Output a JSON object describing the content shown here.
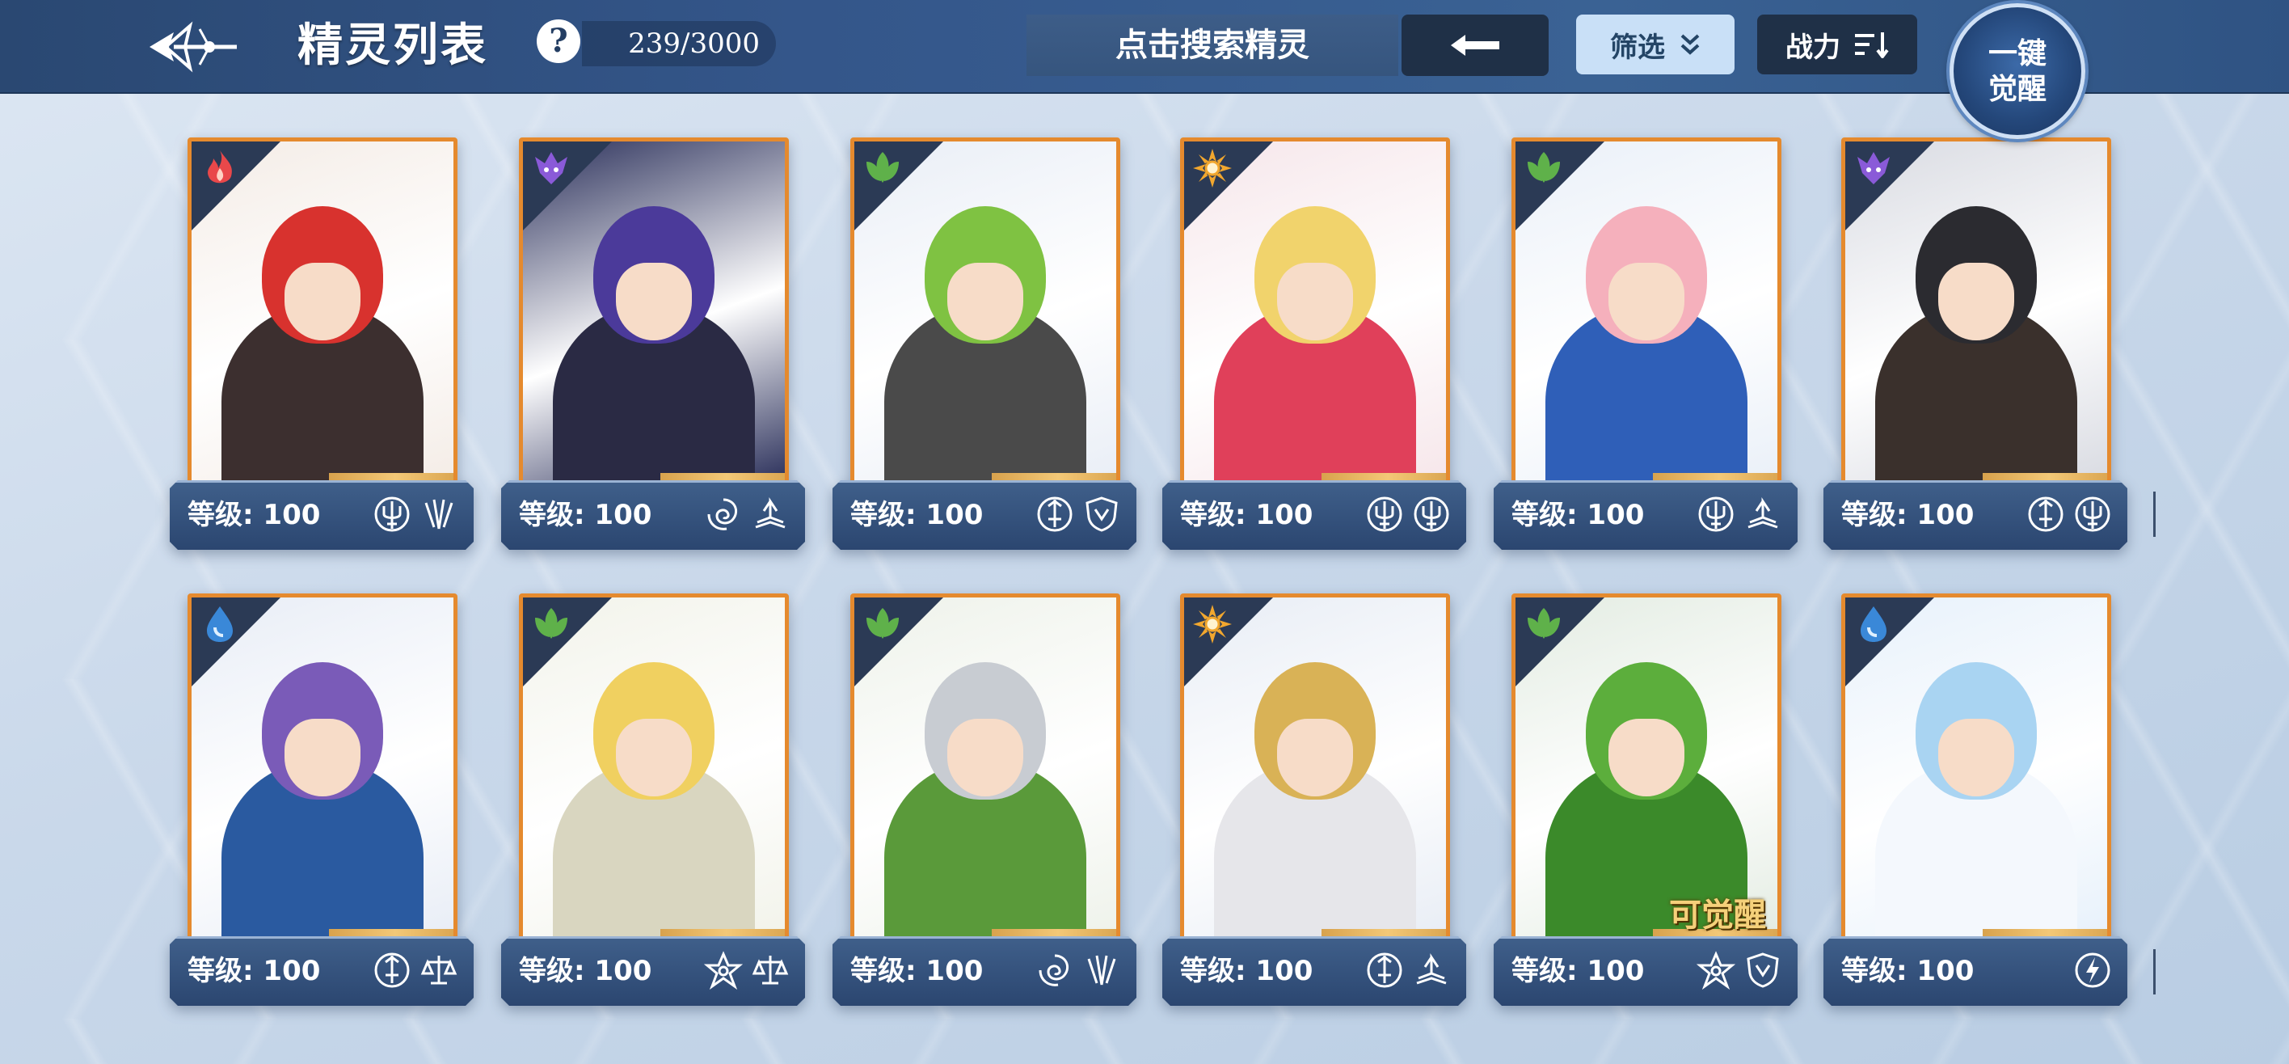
{
  "header": {
    "title": "精灵列表",
    "help_label": "?",
    "count": "239/3000",
    "search_placeholder": "点击搜索精灵",
    "filter_label": "筛选",
    "power_label": "战力",
    "awaken_line1": "一键",
    "awaken_line2": "觉醒"
  },
  "colors": {
    "topbar": "#34568a",
    "card_border": "#e58a2e",
    "info_bar": "#2b4670",
    "fire": "#e9484a",
    "dark": "#8a5ad8",
    "grass": "#5fb14a",
    "light": "#f2a72e",
    "water": "#3a88d8"
  },
  "level_label": "等级: 100",
  "cards": [
    {
      "element": "fire-icon",
      "level": "等级: 100",
      "badges": [
        "trident-icon",
        "claw-icon"
      ],
      "tag": ""
    },
    {
      "element": "dark-icon",
      "level": "等级: 100",
      "badges": [
        "vortex-icon",
        "book-icon"
      ],
      "tag": ""
    },
    {
      "element": "grass-icon",
      "level": "等级: 100",
      "badges": [
        "sword-icon",
        "shield-icon"
      ],
      "tag": ""
    },
    {
      "element": "light-icon",
      "level": "等级: 100",
      "badges": [
        "trident-icon",
        "trident-icon"
      ],
      "tag": ""
    },
    {
      "element": "grass-icon",
      "level": "等级: 100",
      "badges": [
        "trident-icon",
        "book-icon"
      ],
      "tag": ""
    },
    {
      "element": "dark-icon",
      "level": "等级: 100",
      "badges": [
        "sword-icon",
        "trident-icon"
      ],
      "tag": ""
    },
    {
      "element": "water-icon",
      "level": "等级: 100",
      "badges": [
        "sword-icon",
        "scales-icon"
      ],
      "tag": ""
    },
    {
      "element": "grass-icon",
      "level": "等级: 100",
      "badges": [
        "star-icon",
        "scales-icon"
      ],
      "tag": ""
    },
    {
      "element": "grass-icon",
      "level": "等级: 100",
      "badges": [
        "vortex-icon",
        "claw-icon"
      ],
      "tag": ""
    },
    {
      "element": "light-icon",
      "level": "等级: 100",
      "badges": [
        "sword-icon",
        "book-icon"
      ],
      "tag": ""
    },
    {
      "element": "grass-icon",
      "level": "等级: 100",
      "badges": [
        "star-icon",
        "shield-icon"
      ],
      "tag": "可觉醒"
    },
    {
      "element": "water-icon",
      "level": "等级: 100",
      "badges": [
        "lightning-icon"
      ],
      "tag": ""
    }
  ]
}
